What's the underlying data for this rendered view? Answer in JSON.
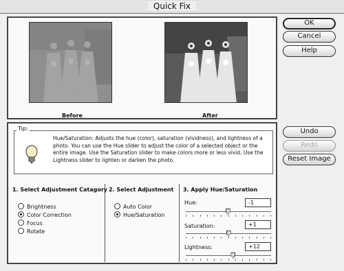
{
  "window": {
    "title": "Quick Fix"
  },
  "preview": {
    "before_label": "Before",
    "after_label": "After"
  },
  "buttons": {
    "ok": "OK",
    "cancel": "Cancel",
    "help": "Help",
    "undo": "Undo",
    "redo": "Redo",
    "reset_image": "Reset Image"
  },
  "tip": {
    "legend": "Tip:",
    "text": "Hue/Saturation: Adjusts the hue (color), saturation (vividness), and lightness of a photo. You can use the Hue slider to adjust the color of a selected object or the entire image. Use the Saturation slider to make colors more or less vivid. Use the Lightness slider to lighten or darken the photo."
  },
  "category": {
    "heading": "1. Select Adjustment Catagory",
    "options": [
      {
        "label": "Brightness",
        "selected": false
      },
      {
        "label": "Color Correction",
        "selected": true
      },
      {
        "label": "Focus",
        "selected": false
      },
      {
        "label": "Rotate",
        "selected": false
      }
    ]
  },
  "adjustment": {
    "heading": "2. Select Adjustment",
    "options": [
      {
        "label": "Auto Color",
        "selected": false
      },
      {
        "label": "Hue/Saturation",
        "selected": true
      }
    ]
  },
  "apply": {
    "heading": "3. Apply Hue/Saturation",
    "sliders": [
      {
        "label": "Hue:",
        "value": "-1",
        "numeric": -1,
        "min": -180,
        "max": 180
      },
      {
        "label": "Saturation:",
        "value": "+1",
        "numeric": 1,
        "min": -100,
        "max": 100
      },
      {
        "label": "Lightness:",
        "value": "+12",
        "numeric": 12,
        "min": -100,
        "max": 100
      }
    ]
  }
}
